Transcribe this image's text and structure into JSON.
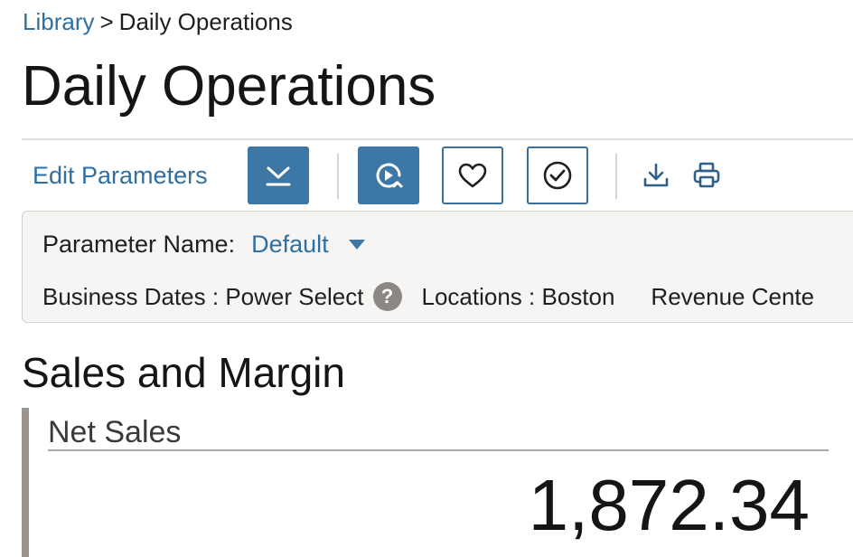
{
  "breadcrumb": {
    "parent": "Library",
    "separator": ">",
    "current": "Daily Operations"
  },
  "page": {
    "title": "Daily Operations"
  },
  "toolbar": {
    "edit_parameters": "Edit Parameters",
    "buttons": [
      {
        "icon": "expand-chevron-icon",
        "style": "solid"
      },
      {
        "icon": "run-refresh-icon",
        "style": "solid"
      },
      {
        "icon": "heart-icon",
        "style": "outline"
      },
      {
        "icon": "check-circle-icon",
        "style": "outline"
      },
      {
        "icon": "download-icon",
        "style": "plain"
      },
      {
        "icon": "print-icon",
        "style": "plain"
      }
    ]
  },
  "parameters": {
    "name_label": "Parameter Name:",
    "name_value": "Default",
    "business_dates": "Business Dates : Power Select",
    "help": "?",
    "locations": "Locations : Boston",
    "revenue_center": "Revenue Cente"
  },
  "section": {
    "title": "Sales and Margin",
    "tile": {
      "label": "Net Sales",
      "value": "1,872.34"
    }
  },
  "colors": {
    "link": "#2f6fa2",
    "button_fill": "#3c77a5",
    "panel_bg": "#f6f5f3",
    "tile_bar": "#9a9490"
  }
}
